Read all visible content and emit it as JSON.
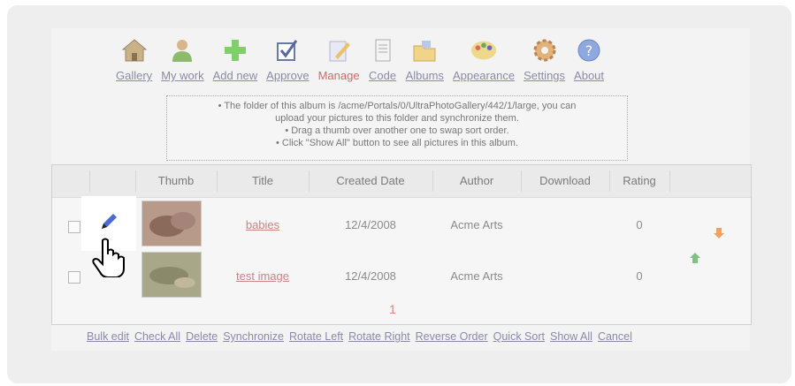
{
  "nav": [
    {
      "label": "Gallery",
      "icon": "house-icon"
    },
    {
      "label": "My work",
      "icon": "user-icon"
    },
    {
      "label": "Add new",
      "icon": "plus-icon"
    },
    {
      "label": "Approve",
      "icon": "checkbox-icon"
    },
    {
      "label": "Manage",
      "icon": "pencil-doc-icon",
      "active": true
    },
    {
      "label": "Code",
      "icon": "document-icon"
    },
    {
      "label": "Albums",
      "icon": "folder-icon"
    },
    {
      "label": "Appearance",
      "icon": "palette-icon"
    },
    {
      "label": "Settings",
      "icon": "gear-icon"
    },
    {
      "label": "About",
      "icon": "help-icon"
    }
  ],
  "info": {
    "line1": "• The folder of this album is /acme/Portals/0/UltraPhotoGallery/442/1/large, you can",
    "line2": "upload your pictures to this folder and synchronize them.",
    "line3": "• Drag a thumb over another one to swap sort order.",
    "line4": "• Click \"Show All\" button to see all pictures in this album."
  },
  "grid": {
    "columns": {
      "thumb": "Thumb",
      "title": "Title",
      "created": "Created Date",
      "author": "Author",
      "download": "Download",
      "rating": "Rating"
    },
    "rows": [
      {
        "title": "babies",
        "created": "12/4/2008",
        "author": "Acme Arts",
        "download": "",
        "rating": "0"
      },
      {
        "title": "test image",
        "created": "12/4/2008",
        "author": "Acme Arts",
        "download": "",
        "rating": "0"
      }
    ]
  },
  "pager": {
    "current": "1"
  },
  "actions": [
    "Bulk edit",
    "Check All",
    "Delete",
    "Synchronize",
    "Rotate Left",
    "Rotate Right",
    "Reverse Order",
    "Quick Sort",
    "Show All",
    "Cancel"
  ],
  "colors": {
    "link": "#8a8aa8",
    "active": "#d26a6a",
    "title_link": "#c98585",
    "arrow_down": "#f0a060",
    "arrow_up": "#80c080"
  }
}
